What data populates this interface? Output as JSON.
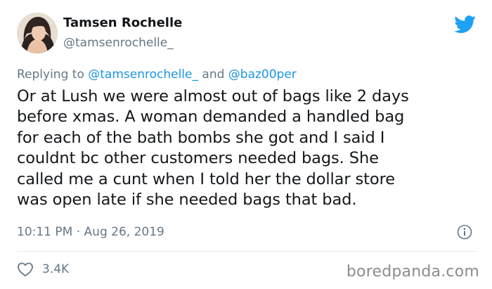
{
  "author": {
    "display_name": "Tamsen Rochelle",
    "handle": "@tamsenrochelle_"
  },
  "reply": {
    "prefix": "Replying to ",
    "mention_1": "@tamsenrochelle_",
    "joiner": " and ",
    "mention_2": "@baz00per"
  },
  "tweet": {
    "lines": [
      "Or at Lush we were almost out of bags like 2 days",
      "before xmas. A woman demanded a handled bag",
      "for each of the bath bombs she got and I said I",
      "couldnt bc other customers needed bags. She",
      "called me a cunt when I told her the dollar store",
      "was open late if she needed bags that bad."
    ]
  },
  "meta": {
    "time": "10:11 PM",
    "separator": " · ",
    "date": "Aug 26, 2019"
  },
  "actions": {
    "like_count": "3.4K"
  },
  "watermark": "boredpanda.com",
  "colors": {
    "twitter_blue": "#1da1f2",
    "mention_blue": "#1b95e0",
    "secondary_text": "#657786",
    "primary_text": "#14171a",
    "divider": "#e1e8ed"
  },
  "icons": [
    "twitter-bird-icon",
    "info-icon",
    "heart-icon"
  ]
}
